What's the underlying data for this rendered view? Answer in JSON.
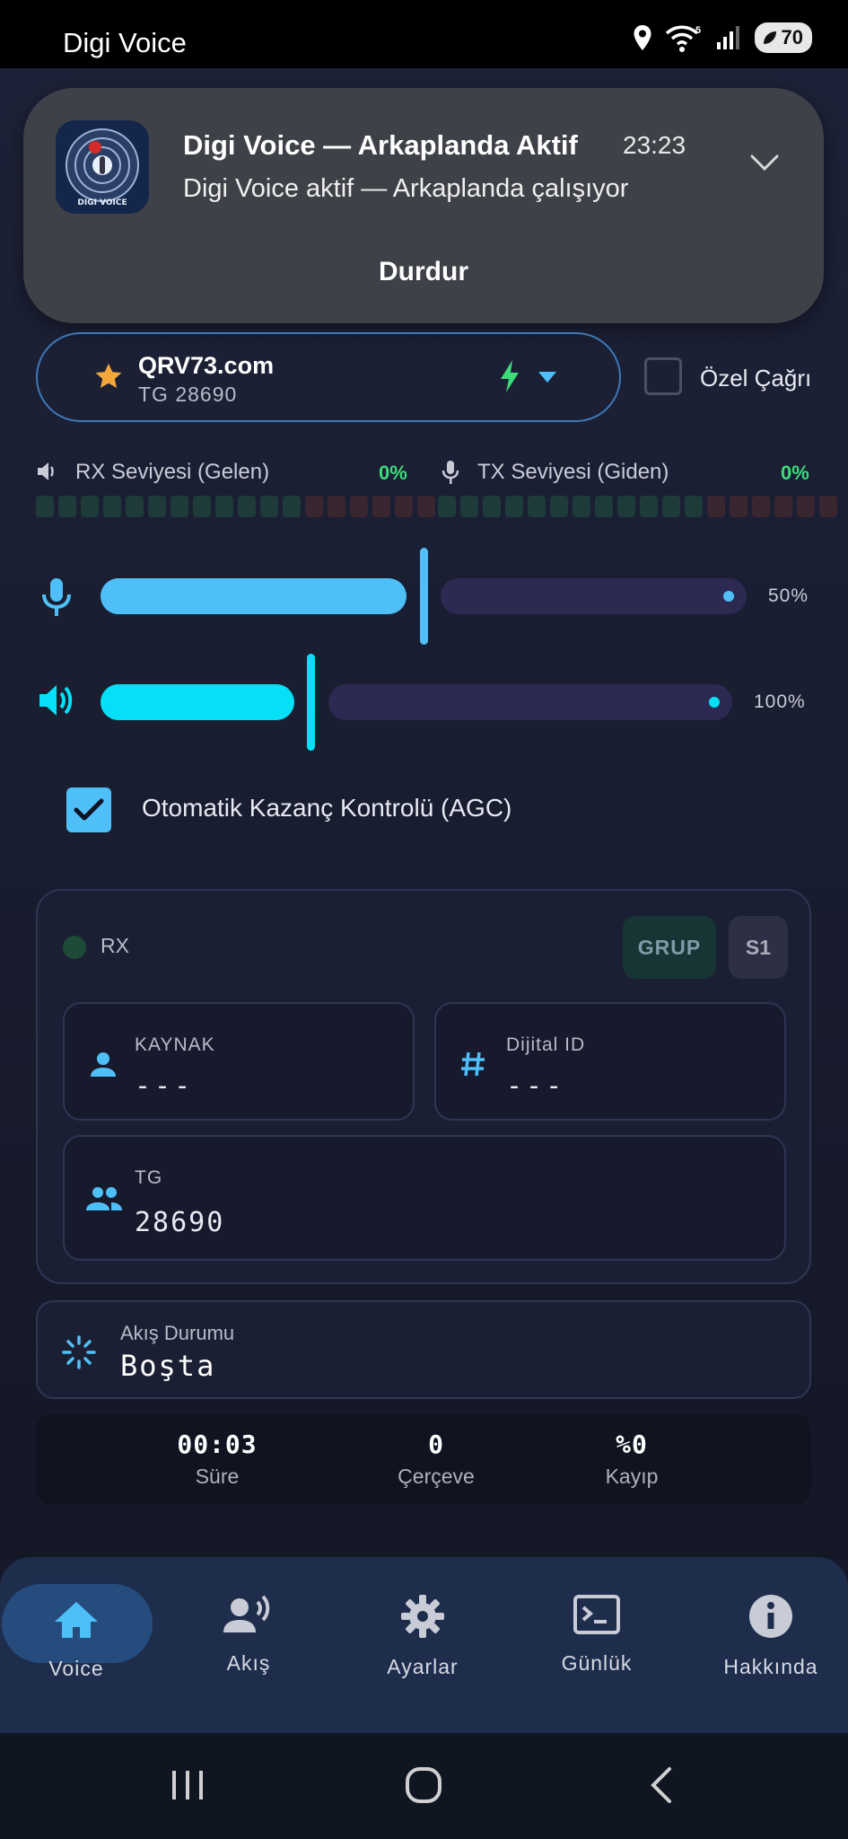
{
  "status_bar": {
    "app_title": "Digi Voice",
    "battery": "70",
    "signal_badge": "5"
  },
  "notification": {
    "title": "Digi Voice — Arkaplanda Aktif",
    "time": "23:23",
    "text": "Digi Voice aktif — Arkaplanda çalışıyor",
    "action": "Durdur",
    "logo_text": "DIGI VOICE"
  },
  "selector": {
    "name": "QRV73.com",
    "subtitle": "TG 28690",
    "private_call_label": "Özel Çağrı",
    "private_call_checked": false
  },
  "meters": {
    "rx": {
      "label": "RX Seviyesi (Gelen)",
      "value": "0%"
    },
    "tx": {
      "label": "TX Seviyesi (Giden)",
      "value": "0%"
    }
  },
  "sliders": {
    "mic": {
      "label": "50%",
      "level": 0.5
    },
    "speaker": {
      "label": "100%",
      "level": 1.0
    }
  },
  "agc": {
    "label": "Otomatik Kazanç Kontrolü (AGC)",
    "checked": true
  },
  "rx_panel": {
    "status": "RX",
    "group_button": "GRUP",
    "slot_button": "S1",
    "source": {
      "label": "KAYNAK",
      "value": "---"
    },
    "digital_id": {
      "label": "Dijital ID",
      "value": "---"
    },
    "tg": {
      "label": "TG",
      "value": "28690"
    }
  },
  "flow": {
    "label": "Akış Durumu",
    "value": "Boşta"
  },
  "stats": [
    {
      "value": "00:03",
      "label": "Süre"
    },
    {
      "value": "0",
      "label": "Çerçeve"
    },
    {
      "value": "%0",
      "label": "Kayıp"
    }
  ],
  "bottom_nav": [
    {
      "label": "Voice",
      "icon": "home-icon",
      "active": true
    },
    {
      "label": "Akış",
      "icon": "voice-stream-icon",
      "active": false
    },
    {
      "label": "Ayarlar",
      "icon": "gear-icon",
      "active": false
    },
    {
      "label": "Günlük",
      "icon": "terminal-icon",
      "active": false
    },
    {
      "label": "Hakkında",
      "icon": "info-icon",
      "active": false
    }
  ],
  "colors": {
    "accent": "#4fc0f7",
    "cyan": "#06e0f6",
    "green": "#3ddc7a",
    "background": "#15192a"
  }
}
